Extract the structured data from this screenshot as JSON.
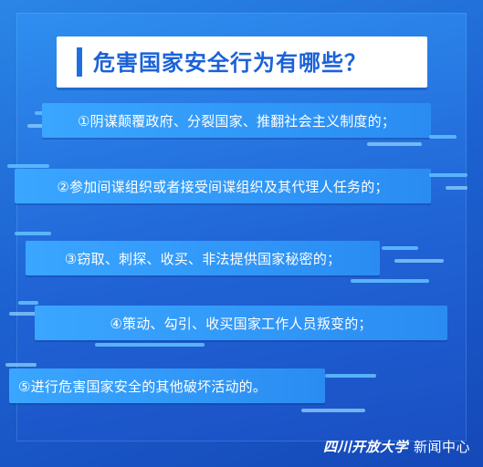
{
  "title": "危害国家安全行为有哪些？",
  "items": [
    "①阴谋颠覆政府、分裂国家、推翻社会主义制度的；",
    "②参加间谍组织或者接受间谍组织及其代理人任务的；",
    "③窃取、刺探、收买、非法提供国家秘密的；",
    "④策动、勾引、收买国家工作人员叛变的；",
    "⑤进行危害国家安全的其他破坏活动的。"
  ],
  "footer": {
    "university": "四川开放大学",
    "center": "新闻中心"
  },
  "colors": {
    "background": "#1d63d2",
    "title_text": "#1b62d8",
    "item_fill": "#2a8cf2",
    "stripe": "#5fbcff"
  }
}
